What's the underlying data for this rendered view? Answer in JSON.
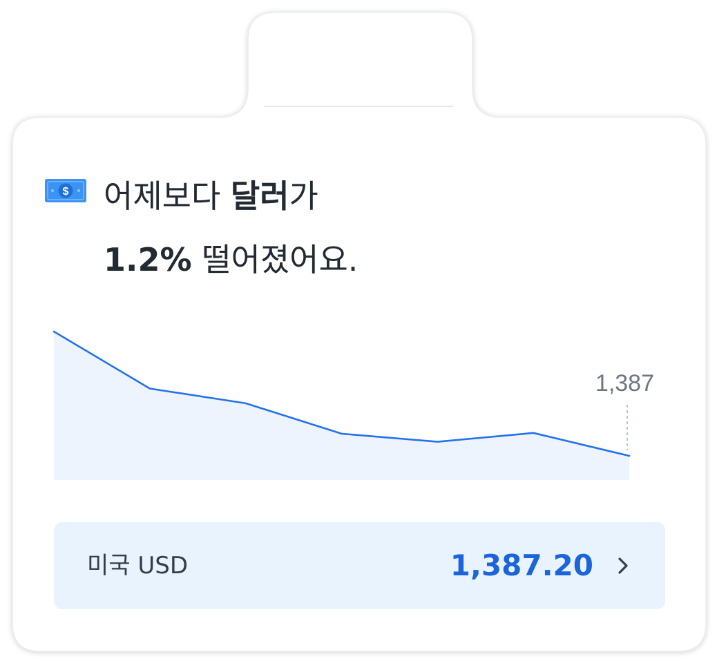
{
  "card": {
    "headline_line1_regular": "어제보다 ",
    "headline_line1_bold": "달러",
    "headline_line1_end": "가",
    "headline_line2_bold": "1.2%",
    "headline_line2_regular": " 떨어졌어요.",
    "icon": "dollar-bill-icon"
  },
  "chart_data": {
    "type": "area",
    "x": [
      1,
      2,
      3,
      4,
      5,
      6,
      7
    ],
    "series": [
      {
        "values": [
          1404.0,
          1396.3,
          1394.3,
          1390.2,
          1389.1,
          1390.3,
          1387.2
        ]
      }
    ],
    "end_label": "1,387",
    "colors": {
      "line": "#2272eb",
      "fill": "#edf4fd"
    }
  },
  "rate": {
    "label": "미국 USD",
    "value": "1,387.20",
    "chevron_icon": "chevron-right-icon"
  },
  "colors": {
    "accent": "#1b64da",
    "headline": "#222a33",
    "rate_row_bg": "#e8f3fe"
  }
}
